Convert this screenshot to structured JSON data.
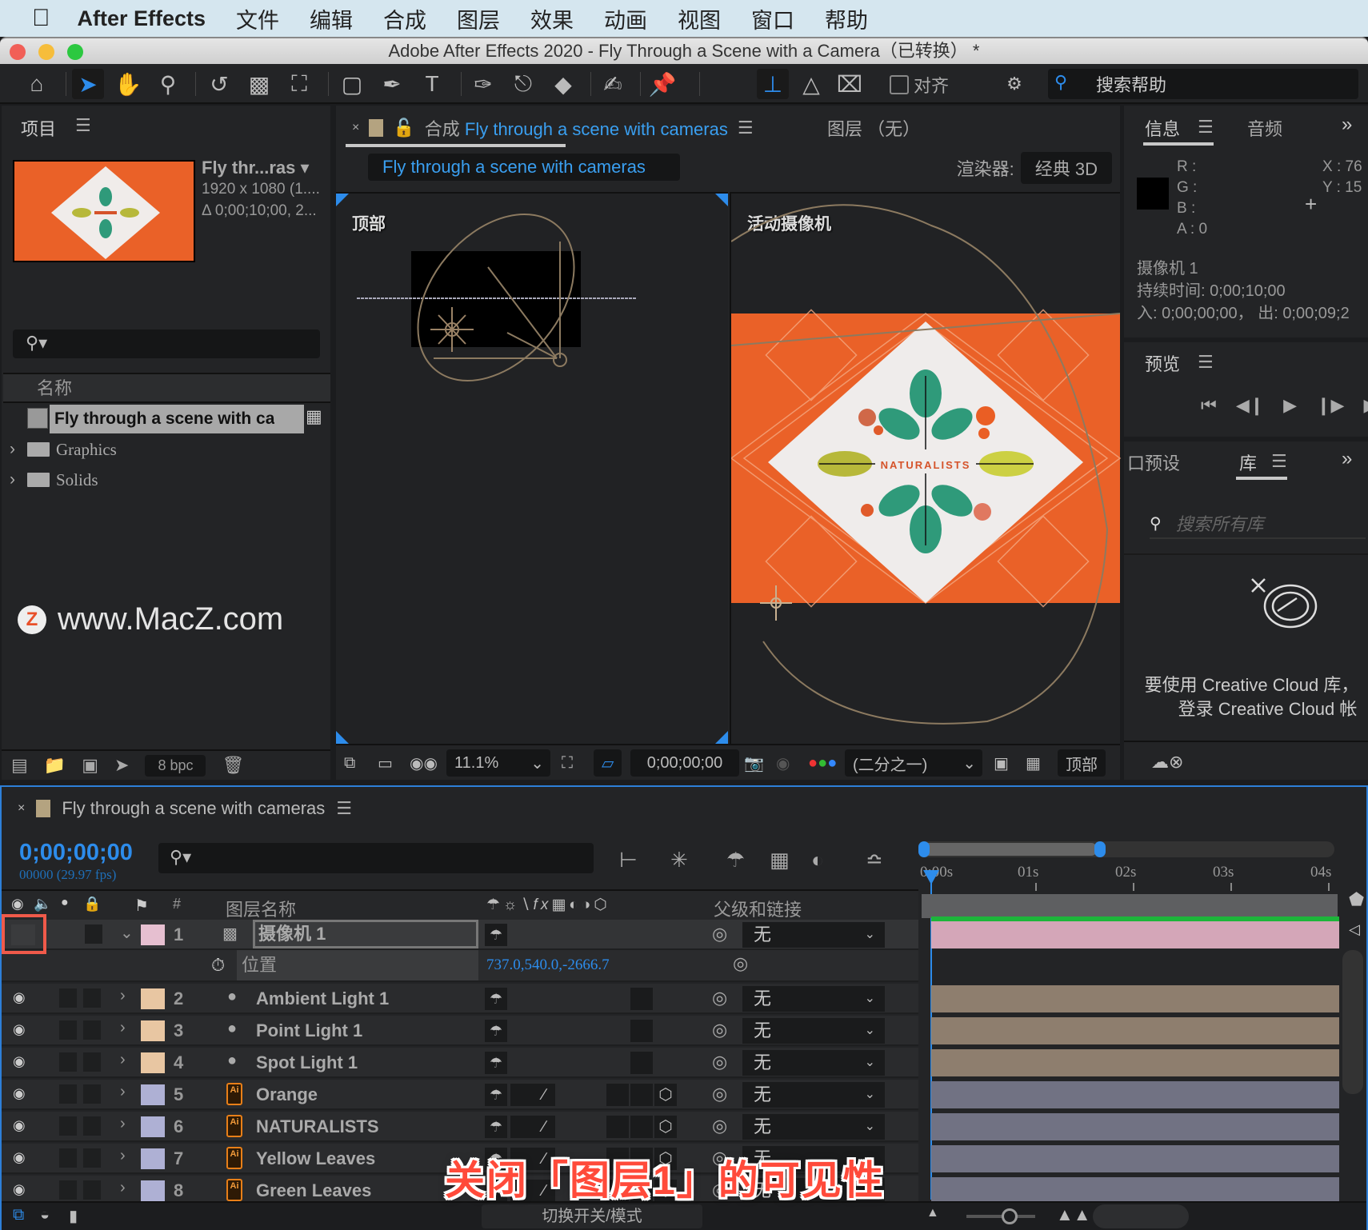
{
  "menubar": {
    "app": "After Effects",
    "items": [
      "文件",
      "编辑",
      "合成",
      "图层",
      "效果",
      "动画",
      "视图",
      "窗口",
      "帮助"
    ]
  },
  "titlebar": {
    "title": "Adobe After Effects 2020 - Fly Through a Scene with a Camera（已转换） *"
  },
  "toolbar": {
    "snap_label": "对齐",
    "help_search_placeholder": "搜索帮助"
  },
  "project": {
    "title": "项目",
    "selected": {
      "name": "Fly thr...ras",
      "dims": "1920 x 1080 (1....",
      "duration": "Δ 0;00;10;00, 2..."
    },
    "column_header": "名称",
    "items": [
      {
        "name": "Fly through a scene with ca",
        "type": "composition",
        "selected": true
      },
      {
        "name": "Graphics",
        "type": "folder"
      },
      {
        "name": "Solids",
        "type": "folder"
      }
    ],
    "bpc": "8 bpc"
  },
  "watermark": {
    "logo": "Z",
    "text": "www.MacZ.com"
  },
  "comp": {
    "tab_prefix": "合成",
    "tab_name": "Fly through a scene with cameras",
    "layer_tab": "图层 （无）",
    "breadcrumb": "Fly through a scene with cameras",
    "renderer_label": "渲染器:",
    "renderer_value": "经典 3D",
    "view_left_label": "顶部",
    "view_right_label": "活动摄像机",
    "artwork_text": "NATURALISTS",
    "zoom": "11.1%",
    "timecode": "0;00;00;00",
    "resolution": "(二分之一)",
    "view_select": "顶部"
  },
  "info": {
    "tab": "信息",
    "tab2": "音频",
    "r": "R :",
    "g": "G :",
    "b": "B :",
    "a": "A :  0",
    "x": "X : 76",
    "y": "Y : 15",
    "layer": "摄像机 1",
    "duration": "持续时间: 0;00;10;00",
    "inout": "入: 0;00;00;00，  出: 0;00;09;2"
  },
  "preview": {
    "tab": "预览"
  },
  "library": {
    "tab_left": "口预设",
    "tab": "库",
    "search_placeholder": "搜索所有库",
    "message_line1": "要使用 Creative Cloud 库，",
    "message_line2": "登录 Creative Cloud 帐"
  },
  "timeline": {
    "tab_name": "Fly through a scene with cameras",
    "timecode": "0;00;00;00",
    "fps": "00000 (29.97 fps)",
    "headers": {
      "hash": "#",
      "layer_name": "图层名称",
      "parent": "父级和链接"
    },
    "ruler": [
      "0:00s",
      "01s",
      "02s",
      "03s",
      "04s"
    ],
    "property": {
      "name": "位置",
      "value": "737.0,540.0,-2666.7"
    },
    "layers": [
      {
        "num": "1",
        "name": "摄像机 1",
        "type": "camera",
        "label_color": "#e6bfd0",
        "parent": "无",
        "visible": false,
        "track_color": "#d4a6b8"
      },
      {
        "num": "2",
        "name": "Ambient Light 1",
        "type": "light",
        "label_color": "#e8c6a2",
        "parent": "无",
        "visible": true,
        "track_color": "#8e7e6e"
      },
      {
        "num": "3",
        "name": "Point Light 1",
        "type": "light",
        "label_color": "#e8c6a2",
        "parent": "无",
        "visible": true,
        "track_color": "#8e7e6e"
      },
      {
        "num": "4",
        "name": "Spot Light 1",
        "type": "light",
        "label_color": "#e8c6a2",
        "parent": "无",
        "visible": true,
        "track_color": "#8e7e6e"
      },
      {
        "num": "5",
        "name": "Orange",
        "type": "ai",
        "label_color": "#aeb0d4",
        "parent": "无",
        "visible": true,
        "track_color": "#717283"
      },
      {
        "num": "6",
        "name": "NATURALISTS",
        "type": "ai",
        "label_color": "#aeb0d4",
        "parent": "无",
        "visible": true,
        "track_color": "#717283"
      },
      {
        "num": "7",
        "name": "Yellow Leaves",
        "type": "ai",
        "label_color": "#aeb0d4",
        "parent": "无",
        "visible": true,
        "track_color": "#717283"
      },
      {
        "num": "8",
        "name": "Green Leaves",
        "type": "ai",
        "label_color": "#aeb0d4",
        "parent": "无",
        "visible": true,
        "track_color": "#717283"
      }
    ],
    "footer_toggle": "切换开关/模式"
  },
  "caption": "关闭「图层1」的可见性",
  "colors": {
    "accent": "#2d8ceb",
    "orange": "#ea6128",
    "highlight_box": "#f05a4a"
  }
}
